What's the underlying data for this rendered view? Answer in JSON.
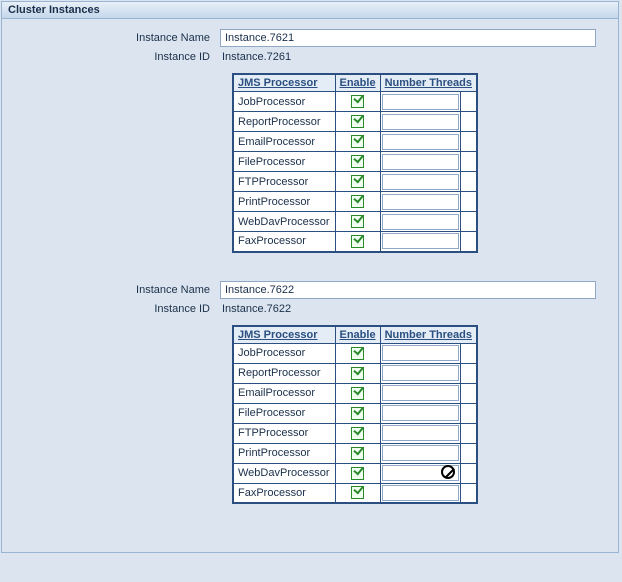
{
  "panel": {
    "title": "Cluster Instances"
  },
  "labels": {
    "instance_name": "Instance Name",
    "instance_id": "Instance ID"
  },
  "table_headers": {
    "jms_processor": "JMS Processor",
    "enable": "Enable",
    "number_threads": "Number Threads"
  },
  "instances": [
    {
      "name_value": "Instance.7621",
      "id_value": "Instance.7261",
      "processors": [
        {
          "name": "JobProcessor",
          "enabled": true,
          "threads": ""
        },
        {
          "name": "ReportProcessor",
          "enabled": true,
          "threads": ""
        },
        {
          "name": "EmailProcessor",
          "enabled": true,
          "threads": ""
        },
        {
          "name": "FileProcessor",
          "enabled": true,
          "threads": ""
        },
        {
          "name": "FTPProcessor",
          "enabled": true,
          "threads": ""
        },
        {
          "name": "PrintProcessor",
          "enabled": true,
          "threads": ""
        },
        {
          "name": "WebDavProcessor",
          "enabled": true,
          "threads": ""
        },
        {
          "name": "FaxProcessor",
          "enabled": true,
          "threads": ""
        }
      ]
    },
    {
      "name_value": "Instance.7622",
      "id_value": "Instance.7622",
      "processors": [
        {
          "name": "JobProcessor",
          "enabled": true,
          "threads": ""
        },
        {
          "name": "ReportProcessor",
          "enabled": true,
          "threads": ""
        },
        {
          "name": "EmailProcessor",
          "enabled": true,
          "threads": ""
        },
        {
          "name": "FileProcessor",
          "enabled": true,
          "threads": ""
        },
        {
          "name": "FTPProcessor",
          "enabled": true,
          "threads": ""
        },
        {
          "name": "PrintProcessor",
          "enabled": true,
          "threads": ""
        },
        {
          "name": "WebDavProcessor",
          "enabled": true,
          "threads": "",
          "show_forbidden_cursor": true
        },
        {
          "name": "FaxProcessor",
          "enabled": true,
          "threads": ""
        }
      ]
    }
  ]
}
